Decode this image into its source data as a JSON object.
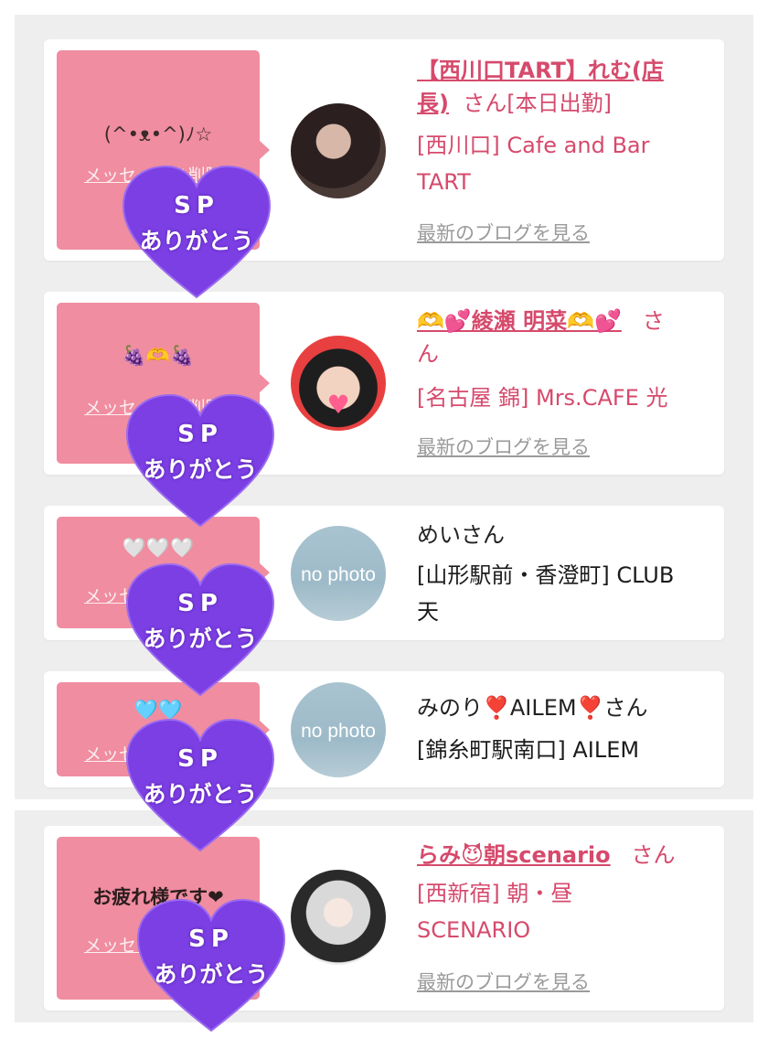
{
  "sticker": {
    "line1": "SP",
    "line2": "ありがとう",
    "color": "#7b3fe4"
  },
  "cards": [
    {
      "message": "(^•ᴥ•^)ﾉ☆",
      "delete_label": "メッセージを削除",
      "name": "【西川口TART】れむ(店長)",
      "name_line1": "【西川口TART】れむ(店",
      "name_line2": "長)",
      "san": "さん",
      "status": "[本日出勤]",
      "shop_line1": "[西川口] Cafe and Bar",
      "shop_line2": "TART",
      "blog_label": "最新のブログを見る"
    },
    {
      "message": "🍇🫶🍇",
      "delete_label": "メッセージを削除",
      "name": "🫶💕綾瀬 明菜🫶💕",
      "san_line1": "さ",
      "san_line2": "ん",
      "shop": "[名古屋 錦] Mrs.CAFE 光",
      "blog_label": "最新のブログを見る"
    },
    {
      "message": "🤍🤍🤍",
      "delete_label": "メッセージを削除",
      "avatar_text": "no photo",
      "name": "めいさん",
      "shop_line1": "[山形駅前・香澄町] CLUB",
      "shop_line2": "天"
    },
    {
      "message": "🩵🩵",
      "delete_label": "メッセージを削除",
      "avatar_text": "no photo",
      "name": "みのり❣️AILEM❣️さん",
      "shop": "[錦糸町駅南口] AILEM"
    },
    {
      "message": "お疲れ様です❤",
      "delete_label": "メッセージを削除",
      "name": "らみ😈朝scenario",
      "san": "さん",
      "shop_line1": "[西新宿] 朝・昼",
      "shop_line2": "SCENARIO",
      "blog_label": "最新のブログを見る"
    }
  ]
}
